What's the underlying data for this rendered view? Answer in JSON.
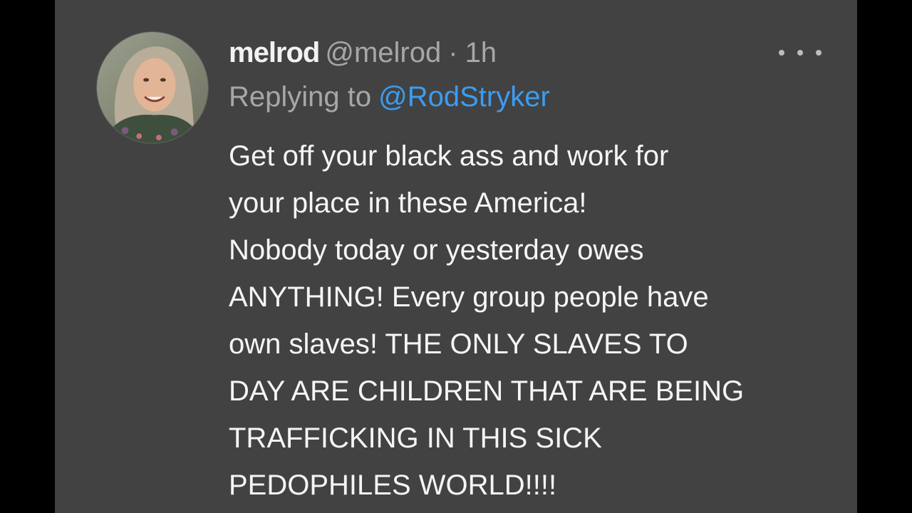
{
  "tweet": {
    "author": {
      "display_name": "melrod",
      "handle": "@melrod",
      "avatar_icon": "user-avatar-photo"
    },
    "separator": "·",
    "timestamp": "1h",
    "more_icon": "more-options-icon",
    "reply": {
      "prefix": "Replying to",
      "to_handle": "@RodStryker"
    },
    "body_lines": [
      "Get off your black ass and work for",
      "your place in these America!",
      "Nobody today or yesterday owes",
      "ANYTHING! Every group people have",
      "own slaves! THE ONLY SLAVES TO",
      "DAY ARE CHILDREN THAT ARE BEING",
      "TRAFFICKING IN THIS SICK",
      "PEDOPHILES WORLD!!!!"
    ]
  },
  "colors": {
    "background": "#424242",
    "letterbox": "#000000",
    "text_primary": "#f5f5f5",
    "text_secondary": "#a7a7a7",
    "link": "#3b9cf0"
  }
}
